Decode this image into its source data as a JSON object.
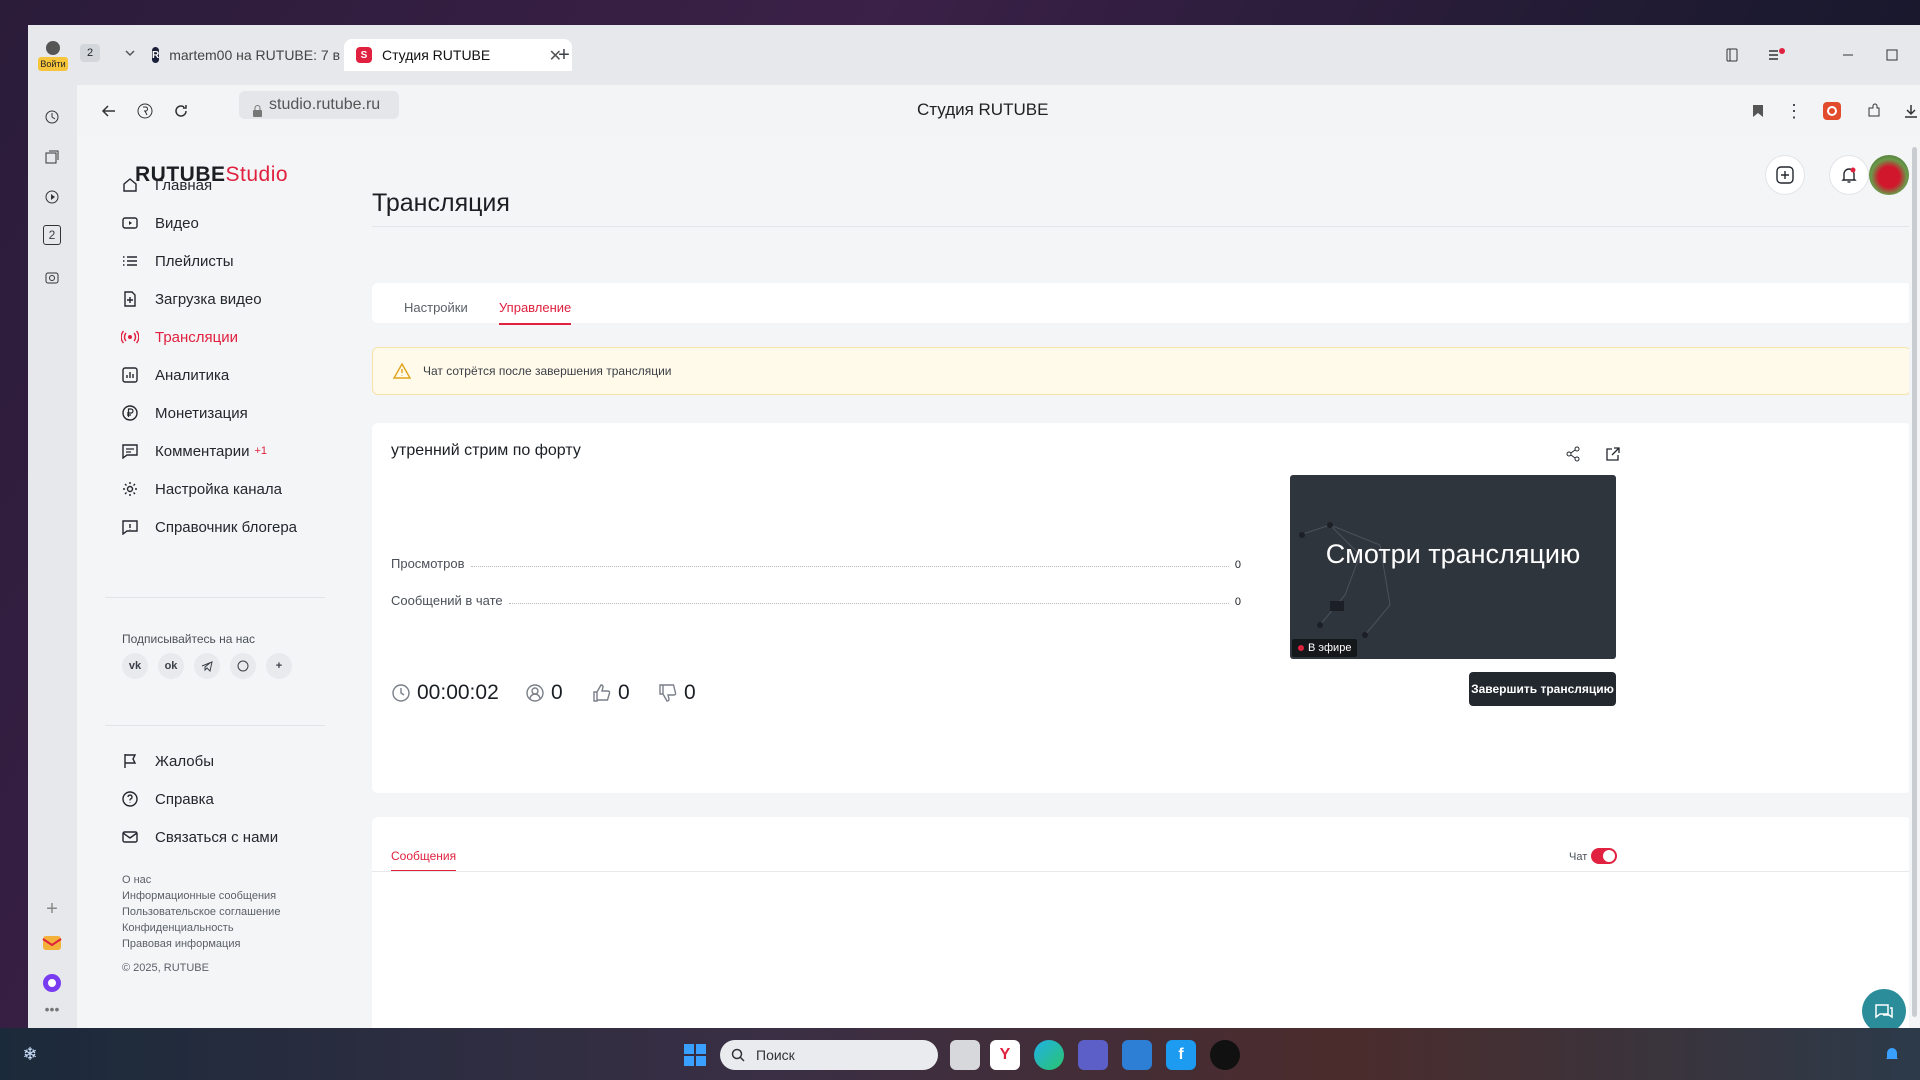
{
  "browser": {
    "profile_label": "Войти",
    "tab_count": "2",
    "tabs": [
      {
        "title": "martem00 на RUTUBE: 7 в"
      },
      {
        "title": "Студия RUTUBE"
      }
    ],
    "url": "studio.rutube.ru",
    "page_title": "Студия RUTUBE",
    "vertical_tab_count": "2"
  },
  "logo": {
    "brand": "RUTUBE",
    "studio": "Studio"
  },
  "sidebar": {
    "items": [
      {
        "label": "Главная"
      },
      {
        "label": "Видео"
      },
      {
        "label": "Плейлисты"
      },
      {
        "label": "Загрузка видео"
      },
      {
        "label": "Трансляции"
      },
      {
        "label": "Аналитика"
      },
      {
        "label": "Монетизация"
      },
      {
        "label": "Комментарии",
        "badge": "+1"
      },
      {
        "label": "Настройка канала"
      },
      {
        "label": "Справочник блогера"
      }
    ],
    "follow_label": "Подписывайтесь на нас",
    "social": [
      "vk",
      "ok",
      "telegram",
      "viber",
      "more"
    ],
    "bottom_items": [
      {
        "label": "Жалобы"
      },
      {
        "label": "Справка"
      },
      {
        "label": "Связаться с нами"
      }
    ],
    "footer_links": [
      "О нас",
      "Информационные сообщения",
      "Пользовательское соглашение",
      "Конфиденциальность",
      "Правовая информация"
    ],
    "copyright": "© 2025, RUTUBE"
  },
  "page": {
    "title": "Трансляция",
    "tabs": [
      "Настройки",
      "Управление"
    ],
    "active_tab": "Управление",
    "warning": "Чат сотрётся после завершения трансляции"
  },
  "stream": {
    "title": "утренний стрим по форту",
    "stats": [
      {
        "label": "Просмотров",
        "value": "0"
      },
      {
        "label": "Сообщений в чате",
        "value": "0"
      }
    ],
    "preview_text": "Смотри трансляцию",
    "live_label": "В эфире",
    "duration": "00:00:02",
    "viewers": "0",
    "likes": "0",
    "dislikes": "0",
    "end_button": "Завершить трансляцию"
  },
  "messages": {
    "tab_label": "Сообщения",
    "chat_label": "Чат",
    "chat_enabled": true
  },
  "taskbar": {
    "search_placeholder": "Поиск"
  },
  "colors": {
    "accent": "#e0213f",
    "dark_button": "#23282f",
    "warning_bg": "#fffaea",
    "help_fab": "#2b8c9a"
  }
}
